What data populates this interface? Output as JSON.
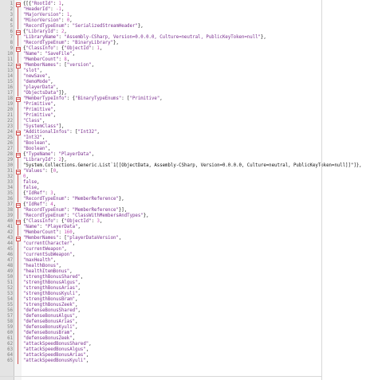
{
  "editor": {
    "lines": [
      {
        "n": "1",
        "fold": "box",
        "tokens": [
          [
            "pun",
            "{[{"
          ],
          [
            "str",
            "\"RootId\""
          ],
          [
            "pun",
            ": "
          ],
          [
            "num",
            "1"
          ],
          [
            "pun",
            ","
          ]
        ]
      },
      {
        "n": "2",
        "fold": "bar",
        "tokens": [
          [
            "str",
            "\"HeaderId\""
          ],
          [
            "pun",
            ": "
          ],
          [
            "num",
            "-1"
          ],
          [
            "pun",
            ","
          ]
        ]
      },
      {
        "n": "3",
        "fold": "bar",
        "tokens": [
          [
            "str",
            "\"MajorVersion\""
          ],
          [
            "pun",
            ": "
          ],
          [
            "num",
            "1"
          ],
          [
            "pun",
            ","
          ]
        ]
      },
      {
        "n": "4",
        "fold": "bar",
        "tokens": [
          [
            "str",
            "\"MinorVersion\""
          ],
          [
            "pun",
            ": "
          ],
          [
            "num",
            "0"
          ],
          [
            "pun",
            ","
          ]
        ]
      },
      {
        "n": "5",
        "fold": "bar",
        "tokens": [
          [
            "str",
            "\"RecordTypeEnum\""
          ],
          [
            "pun",
            ": "
          ],
          [
            "str",
            "\"SerializedStreamHeader\""
          ],
          [
            "pun",
            "},"
          ]
        ]
      },
      {
        "n": "6",
        "fold": "box",
        "tokens": [
          [
            "pun",
            "{"
          ],
          [
            "str",
            "\"LibraryId\""
          ],
          [
            "pun",
            ": "
          ],
          [
            "num",
            "2"
          ],
          [
            "pun",
            ","
          ]
        ]
      },
      {
        "n": "7",
        "fold": "bar",
        "tokens": [
          [
            "str",
            "\"LibraryName\""
          ],
          [
            "pun",
            ": "
          ],
          [
            "str",
            "\"Assembly-CSharp, Version=0.0.0.0, Culture=neutral, PublicKeyToken=null\""
          ],
          [
            "pun",
            "},"
          ]
        ]
      },
      {
        "n": "8",
        "fold": "bar",
        "tokens": [
          [
            "str",
            "\"RecordTypeEnum\""
          ],
          [
            "pun",
            ": "
          ],
          [
            "str",
            "\"BinaryLibrary\""
          ],
          [
            "pun",
            "},"
          ]
        ]
      },
      {
        "n": "9",
        "fold": "box",
        "tokens": [
          [
            "pun",
            "{"
          ],
          [
            "str",
            "\"ClassInfo\""
          ],
          [
            "pun",
            ": {"
          ],
          [
            "str",
            "\"ObjectId\""
          ],
          [
            "pun",
            ": "
          ],
          [
            "num",
            "1"
          ],
          [
            "pun",
            ","
          ]
        ]
      },
      {
        "n": "10",
        "fold": "bar",
        "tokens": [
          [
            "str",
            "\"Name\""
          ],
          [
            "pun",
            ": "
          ],
          [
            "str",
            "\"SaveFile\""
          ],
          [
            "pun",
            ","
          ]
        ]
      },
      {
        "n": "11",
        "fold": "bar",
        "tokens": [
          [
            "str",
            "\"MemberCount\""
          ],
          [
            "pun",
            ": "
          ],
          [
            "num",
            "8"
          ],
          [
            "pun",
            ","
          ]
        ]
      },
      {
        "n": "12",
        "fold": "box",
        "tokens": [
          [
            "str",
            "\"MemberNames\""
          ],
          [
            "pun",
            ": ["
          ],
          [
            "str",
            "\"version\""
          ],
          [
            "pun",
            ","
          ]
        ]
      },
      {
        "n": "13",
        "fold": "bar",
        "tokens": [
          [
            "str",
            "\"slot\""
          ],
          [
            "pun",
            ","
          ]
        ]
      },
      {
        "n": "14",
        "fold": "bar",
        "tokens": [
          [
            "str",
            "\"newSave\""
          ],
          [
            "pun",
            ","
          ]
        ]
      },
      {
        "n": "15",
        "fold": "bar",
        "tokens": [
          [
            "str",
            "\"demoMode\""
          ],
          [
            "pun",
            ","
          ]
        ]
      },
      {
        "n": "16",
        "fold": "bar",
        "tokens": [
          [
            "str",
            "\"playerData\""
          ],
          [
            "pun",
            ","
          ]
        ]
      },
      {
        "n": "17",
        "fold": "bar",
        "tokens": [
          [
            "str",
            "\"ObjectsData\""
          ],
          [
            "pun",
            "]},"
          ]
        ]
      },
      {
        "n": "18",
        "fold": "box",
        "tokens": [
          [
            "str",
            "\"MemberTypeInfo\""
          ],
          [
            "pun",
            ": {"
          ],
          [
            "str",
            "\"BinaryTypeEnums\""
          ],
          [
            "pun",
            ": ["
          ],
          [
            "str",
            "\"Primitive\""
          ],
          [
            "pun",
            ","
          ]
        ]
      },
      {
        "n": "19",
        "fold": "bar",
        "tokens": [
          [
            "str",
            "\"Primitive\""
          ],
          [
            "pun",
            ","
          ]
        ]
      },
      {
        "n": "20",
        "fold": "bar",
        "tokens": [
          [
            "str",
            "\"Primitive\""
          ],
          [
            "pun",
            ","
          ]
        ]
      },
      {
        "n": "21",
        "fold": "bar",
        "tokens": [
          [
            "str",
            "\"Primitive\""
          ],
          [
            "pun",
            ","
          ]
        ]
      },
      {
        "n": "22",
        "fold": "bar",
        "tokens": [
          [
            "str",
            "\"Class\""
          ],
          [
            "pun",
            ","
          ]
        ]
      },
      {
        "n": "23",
        "fold": "bar",
        "tokens": [
          [
            "str",
            "\"SystemClass\""
          ],
          [
            "pun",
            "],"
          ]
        ]
      },
      {
        "n": "24",
        "fold": "box",
        "tokens": [
          [
            "str",
            "\"AdditionalInfos\""
          ],
          [
            "pun",
            ": ["
          ],
          [
            "str",
            "\"Int32\""
          ],
          [
            "pun",
            ","
          ]
        ]
      },
      {
        "n": "25",
        "fold": "bar",
        "tokens": [
          [
            "str",
            "\"Int32\""
          ],
          [
            "pun",
            ","
          ]
        ]
      },
      {
        "n": "26",
        "fold": "bar",
        "tokens": [
          [
            "str",
            "\"Boolean\""
          ],
          [
            "pun",
            ","
          ]
        ]
      },
      {
        "n": "27",
        "fold": "bar",
        "tokens": [
          [
            "str",
            "\"Boolean\""
          ],
          [
            "pun",
            ","
          ]
        ]
      },
      {
        "n": "28",
        "fold": "box",
        "tokens": [
          [
            "pun",
            "{"
          ],
          [
            "str",
            "\"TypeName\""
          ],
          [
            "pun",
            ": "
          ],
          [
            "str",
            "\"PlayerData\""
          ],
          [
            "pun",
            ","
          ]
        ]
      },
      {
        "n": "29",
        "fold": "bar",
        "tokens": [
          [
            "str",
            "\"LibraryId\""
          ],
          [
            "pun",
            ": "
          ],
          [
            "num",
            "2"
          ],
          [
            "pun",
            "},"
          ]
        ]
      },
      {
        "n": "30",
        "fold": "bar",
        "tokens": [
          [
            "pun",
            "\"System.Collections.Generic.List`1[[ObjectData, Assembly-CSharp, Version=0.0.0.0, Culture=neutral, PublicKeyToken=null]]\"]},"
          ]
        ]
      },
      {
        "n": "31",
        "fold": "box",
        "tokens": [
          [
            "str",
            "\"Values\""
          ],
          [
            "pun",
            ": ["
          ],
          [
            "num",
            "0"
          ],
          [
            "pun",
            ","
          ]
        ]
      },
      {
        "n": "32",
        "fold": "bar",
        "tokens": [
          [
            "num",
            "0"
          ],
          [
            "pun",
            ","
          ]
        ]
      },
      {
        "n": "33",
        "fold": "bar",
        "tokens": [
          [
            "str",
            "false"
          ],
          [
            "pun",
            ","
          ]
        ]
      },
      {
        "n": "34",
        "fold": "bar",
        "tokens": [
          [
            "str",
            "false"
          ],
          [
            "pun",
            ","
          ]
        ]
      },
      {
        "n": "35",
        "fold": "bar",
        "tokens": [
          [
            "pun",
            "{"
          ],
          [
            "str",
            "\"IdRef\""
          ],
          [
            "pun",
            ": "
          ],
          [
            "num",
            "3"
          ],
          [
            "pun",
            ","
          ]
        ]
      },
      {
        "n": "36",
        "fold": "bar",
        "tokens": [
          [
            "str",
            "\"RecordTypeEnum\""
          ],
          [
            "pun",
            ": "
          ],
          [
            "str",
            "\"MemberReference\""
          ],
          [
            "pun",
            "},"
          ]
        ]
      },
      {
        "n": "37",
        "fold": "box",
        "tokens": [
          [
            "pun",
            "{"
          ],
          [
            "str",
            "\"IdRef\""
          ],
          [
            "pun",
            ": "
          ],
          [
            "num",
            "4"
          ],
          [
            "pun",
            ","
          ]
        ]
      },
      {
        "n": "38",
        "fold": "bar",
        "tokens": [
          [
            "str",
            "\"RecordTypeEnum\""
          ],
          [
            "pun",
            ": "
          ],
          [
            "str",
            "\"MemberReference\""
          ],
          [
            "pun",
            "}],"
          ]
        ]
      },
      {
        "n": "39",
        "fold": "bar",
        "tokens": [
          [
            "str",
            "\"RecordTypeEnum\""
          ],
          [
            "pun",
            ": "
          ],
          [
            "str",
            "\"ClassWithMembersAndTypes\""
          ],
          [
            "pun",
            "},"
          ]
        ]
      },
      {
        "n": "40",
        "fold": "box",
        "tokens": [
          [
            "pun",
            "{"
          ],
          [
            "str",
            "\"ClassInfo\""
          ],
          [
            "pun",
            ": {"
          ],
          [
            "str",
            "\"ObjectId\""
          ],
          [
            "pun",
            ": "
          ],
          [
            "num",
            "3"
          ],
          [
            "pun",
            ","
          ]
        ]
      },
      {
        "n": "41",
        "fold": "bar",
        "tokens": [
          [
            "str",
            "\"Name\""
          ],
          [
            "pun",
            ": "
          ],
          [
            "str",
            "\"PlayerData\""
          ],
          [
            "pun",
            ","
          ]
        ]
      },
      {
        "n": "42",
        "fold": "bar",
        "tokens": [
          [
            "str",
            "\"MemberCount\""
          ],
          [
            "pun",
            ": "
          ],
          [
            "num",
            "160"
          ],
          [
            "pun",
            ","
          ]
        ]
      },
      {
        "n": "43",
        "fold": "box",
        "tokens": [
          [
            "str",
            "\"MemberNames\""
          ],
          [
            "pun",
            ": ["
          ],
          [
            "str",
            "\"playerDataVersion\""
          ],
          [
            "pun",
            ","
          ]
        ]
      },
      {
        "n": "44",
        "fold": "bar",
        "tokens": [
          [
            "str",
            "\"currentCharacter\""
          ],
          [
            "pun",
            ","
          ]
        ]
      },
      {
        "n": "45",
        "fold": "bar",
        "tokens": [
          [
            "str",
            "\"currentWeapon\""
          ],
          [
            "pun",
            ","
          ]
        ]
      },
      {
        "n": "46",
        "fold": "bar",
        "tokens": [
          [
            "str",
            "\"currentSubWeapon\""
          ],
          [
            "pun",
            ","
          ]
        ]
      },
      {
        "n": "47",
        "fold": "bar",
        "tokens": [
          [
            "str",
            "\"maxHealth\""
          ],
          [
            "pun",
            ","
          ]
        ]
      },
      {
        "n": "48",
        "fold": "bar",
        "tokens": [
          [
            "str",
            "\"healthBonus\""
          ],
          [
            "pun",
            ","
          ]
        ]
      },
      {
        "n": "49",
        "fold": "bar",
        "tokens": [
          [
            "str",
            "\"healthItemBonus\""
          ],
          [
            "pun",
            ","
          ]
        ]
      },
      {
        "n": "50",
        "fold": "bar",
        "tokens": [
          [
            "str",
            "\"strengthBonusShared\""
          ],
          [
            "pun",
            ","
          ]
        ]
      },
      {
        "n": "51",
        "fold": "bar",
        "tokens": [
          [
            "str",
            "\"strengthBonusAlgus\""
          ],
          [
            "pun",
            ","
          ]
        ]
      },
      {
        "n": "52",
        "fold": "bar",
        "tokens": [
          [
            "str",
            "\"strengthBonusArias\""
          ],
          [
            "pun",
            ","
          ]
        ]
      },
      {
        "n": "53",
        "fold": "bar",
        "tokens": [
          [
            "str",
            "\"strengthBonusKyuli\""
          ],
          [
            "pun",
            ","
          ]
        ]
      },
      {
        "n": "54",
        "fold": "bar",
        "tokens": [
          [
            "str",
            "\"strengthBonusBram\""
          ],
          [
            "pun",
            ","
          ]
        ]
      },
      {
        "n": "55",
        "fold": "bar",
        "tokens": [
          [
            "str",
            "\"strengthBonusZeek\""
          ],
          [
            "pun",
            ","
          ]
        ]
      },
      {
        "n": "56",
        "fold": "bar",
        "tokens": [
          [
            "str",
            "\"defenseBonusShared\""
          ],
          [
            "pun",
            ","
          ]
        ]
      },
      {
        "n": "57",
        "fold": "bar",
        "tokens": [
          [
            "str",
            "\"defenseBonusAlgus\""
          ],
          [
            "pun",
            ","
          ]
        ]
      },
      {
        "n": "58",
        "fold": "bar",
        "tokens": [
          [
            "str",
            "\"defenseBonusArias\""
          ],
          [
            "pun",
            ","
          ]
        ]
      },
      {
        "n": "59",
        "fold": "bar",
        "tokens": [
          [
            "str",
            "\"defenseBonusKyuli\""
          ],
          [
            "pun",
            ","
          ]
        ]
      },
      {
        "n": "60",
        "fold": "bar",
        "tokens": [
          [
            "str",
            "\"defenseBonusBram\""
          ],
          [
            "pun",
            ","
          ]
        ]
      },
      {
        "n": "61",
        "fold": "bar",
        "tokens": [
          [
            "str",
            "\"defenseBonusZeek\""
          ],
          [
            "pun",
            ","
          ]
        ]
      },
      {
        "n": "62",
        "fold": "bar",
        "tokens": [
          [
            "str",
            "\"attackSpeedBonusShared\""
          ],
          [
            "pun",
            ","
          ]
        ]
      },
      {
        "n": "63",
        "fold": "bar",
        "tokens": [
          [
            "str",
            "\"attackSpeedBonusAlgus\""
          ],
          [
            "pun",
            ","
          ]
        ]
      },
      {
        "n": "64",
        "fold": "bar",
        "tokens": [
          [
            "str",
            "\"attackSpeedBonusArias\""
          ],
          [
            "pun",
            ","
          ]
        ]
      },
      {
        "n": "65",
        "fold": "bar",
        "tokens": [
          [
            "str",
            "\"attackSpeedBonusKyuli\""
          ],
          [
            "pun",
            ","
          ]
        ]
      }
    ]
  },
  "colors": {
    "string": "#7a2f8f",
    "number": "#c54fb4",
    "punctuation": "#111111",
    "line_number": "#7d7d7d",
    "gutter_background": "#e4e4e4",
    "fold_marker": "#d05050",
    "editor_background": "#ffffff"
  }
}
